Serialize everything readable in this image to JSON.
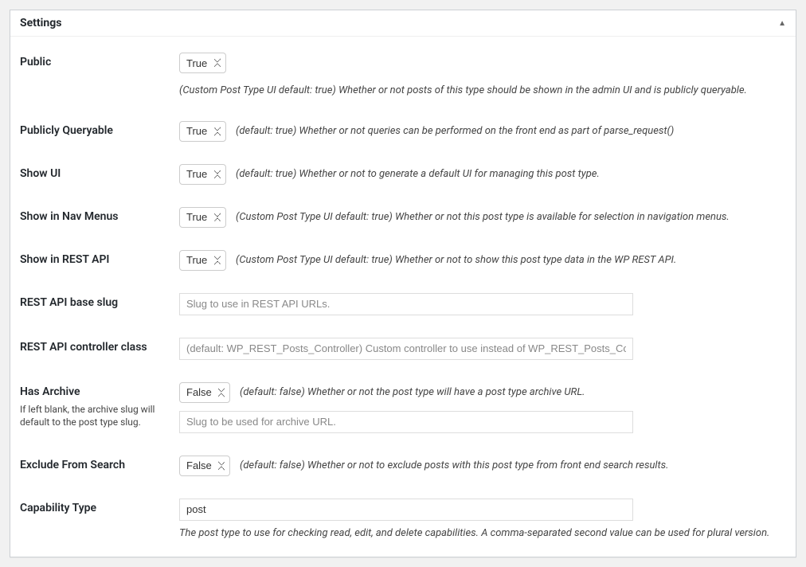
{
  "panel": {
    "title": "Settings"
  },
  "rows": {
    "public": {
      "label": "Public",
      "value": "True",
      "desc": "(Custom Post Type UI default: true) Whether or not posts of this type should be shown in the admin UI and is publicly queryable."
    },
    "publiclyQueryable": {
      "label": "Publicly Queryable",
      "value": "True",
      "desc": "(default: true) Whether or not queries can be performed on the front end as part of parse_request()"
    },
    "showUi": {
      "label": "Show UI",
      "value": "True",
      "desc": "(default: true) Whether or not to generate a default UI for managing this post type."
    },
    "showInNav": {
      "label": "Show in Nav Menus",
      "value": "True",
      "desc": "(Custom Post Type UI default: true) Whether or not this post type is available for selection in navigation menus."
    },
    "showInRest": {
      "label": "Show in REST API",
      "value": "True",
      "desc": "(Custom Post Type UI default: true) Whether or not to show this post type data in the WP REST API."
    },
    "restSlug": {
      "label": "REST API base slug",
      "value": "",
      "placeholder": "Slug to use in REST API URLs."
    },
    "restController": {
      "label": "REST API controller class",
      "value": "",
      "placeholder": "(default: WP_REST_Posts_Controller) Custom controller to use instead of WP_REST_Posts_Cont"
    },
    "hasArchive": {
      "label": "Has Archive",
      "sublabel": "If left blank, the archive slug will default to the post type slug.",
      "value": "False",
      "desc": "(default: false) Whether or not the post type will have a post type archive URL.",
      "slugValue": "",
      "slugPlaceholder": "Slug to be used for archive URL."
    },
    "excludeSearch": {
      "label": "Exclude From Search",
      "value": "False",
      "desc": "(default: false) Whether or not to exclude posts with this post type from front end search results."
    },
    "capability": {
      "label": "Capability Type",
      "value": "post",
      "desc": "The post type to use for checking read, edit, and delete capabilities. A comma-separated second value can be used for plural version."
    }
  },
  "selectOptions": {
    "true": "True",
    "false": "False"
  }
}
